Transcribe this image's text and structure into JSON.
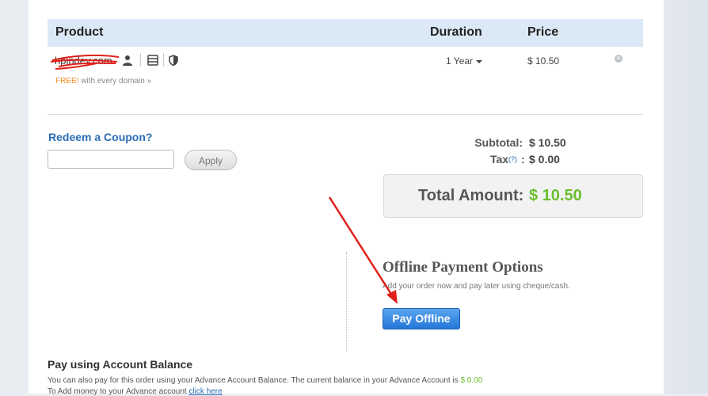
{
  "table": {
    "headers": {
      "product": "Product",
      "duration": "Duration",
      "price": "Price"
    },
    "rows": [
      {
        "domain": "hpindey.com",
        "free_prefix": "FREE!",
        "free_suffix": "with every domain »",
        "duration": "1 Year",
        "price": "$ 10.50",
        "icons": [
          "user-icon",
          "server-icon",
          "shield-icon"
        ]
      }
    ]
  },
  "coupon": {
    "title": "Redeem a Coupon?",
    "input_value": "",
    "apply_label": "Apply"
  },
  "summary": {
    "subtotal_label": "Subtotal:",
    "subtotal_value": "$ 10.50",
    "tax_label": "Tax",
    "tax_help": "(?)",
    "tax_colon": ":",
    "tax_value": "$ 0.00",
    "total_label": "Total Amount:",
    "total_value": "$ 10.50"
  },
  "offline": {
    "title": "Offline Payment Options",
    "description": "Add your order now and pay later using cheque/cash.",
    "button_label": "Pay Offline"
  },
  "account_balance": {
    "title": "Pay using Account Balance",
    "description": "You can also pay for this order using your Advance Account Balance. The current balance in your Advance Account is",
    "balance": "$ 0.00",
    "add_money_text": "To Add money to your Advance account",
    "add_money_link": "click here"
  },
  "colors": {
    "header_bg": "#dbe9f7",
    "link_blue": "#2a6db5",
    "money_green": "#6bbf2f",
    "button_blue": "#2476d8",
    "annotation_red": "#e0201b"
  }
}
